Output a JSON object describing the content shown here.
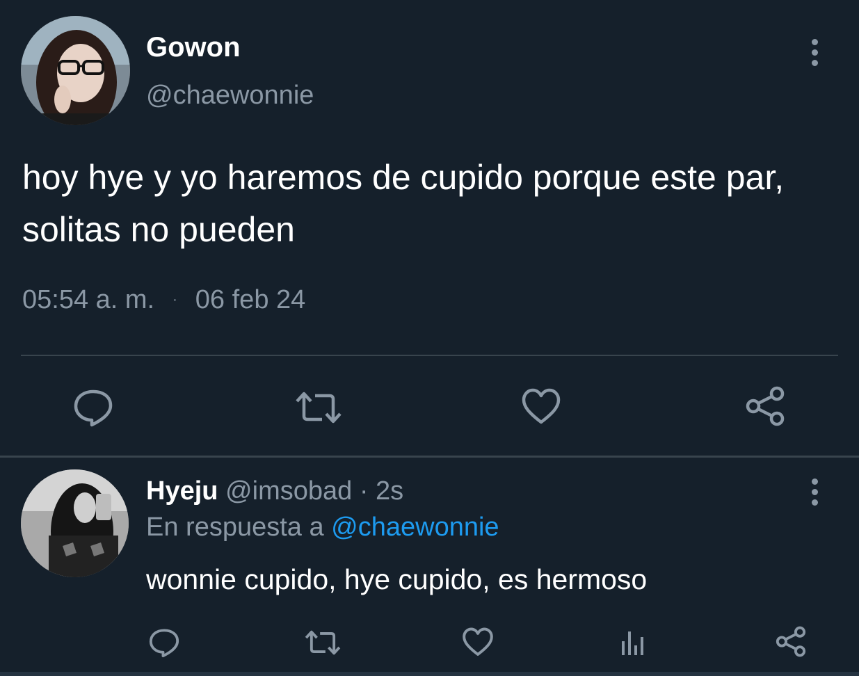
{
  "main_tweet": {
    "author_name": "Gowon",
    "author_handle": "@chaewonnie",
    "text": "hoy hye y yo haremos de cupido porque este par, solitas no pueden",
    "time": "05:54 a. m.",
    "separator": "·",
    "date": "06 feb 24",
    "actions": [
      "reply-icon",
      "retweet-icon",
      "like-icon",
      "share-icon"
    ],
    "menu_icon": "more-vertical-icon",
    "avatar_description": "girl-with-glasses"
  },
  "reply_tweet": {
    "author_name": "Hyeju",
    "author_handle": "@imsobad",
    "dot": "·",
    "time": "2s",
    "reply_prefix": "En respuesta a",
    "reply_mention": "@chaewonnie",
    "text": "wonnie cupido, hye cupido, es hermoso",
    "actions": [
      "reply-icon",
      "retweet-icon",
      "like-icon",
      "analytics-icon",
      "share-icon"
    ],
    "menu_icon": "more-vertical-icon"
  },
  "colors": {
    "background": "#15202b",
    "text_primary": "#ffffff",
    "text_secondary": "#8b98a5",
    "accent": "#1d9bf0",
    "divider": "#38444d"
  }
}
